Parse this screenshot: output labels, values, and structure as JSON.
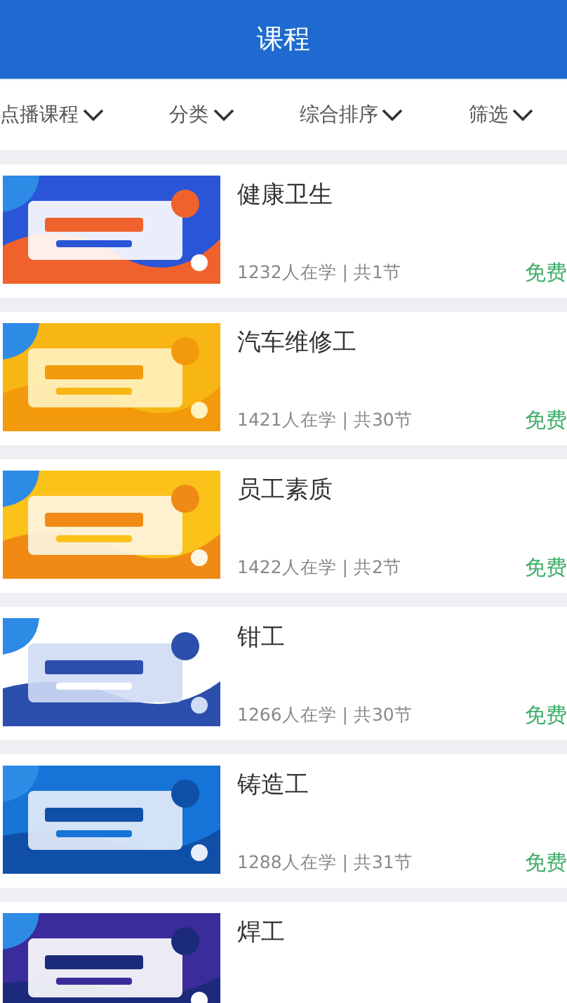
{
  "header": {
    "title": "课程"
  },
  "filters": [
    {
      "label": "点播课程"
    },
    {
      "label": "分类"
    },
    {
      "label": "综合排序"
    },
    {
      "label": "筛选"
    }
  ],
  "courses": [
    {
      "title": "健康卫生",
      "stats": "1232人在学 | 共1节",
      "price": "免费"
    },
    {
      "title": "汽车维修工",
      "stats": "1421人在学 | 共30节",
      "price": "免费"
    },
    {
      "title": "员工素质",
      "stats": "1422人在学 | 共2节",
      "price": "免费"
    },
    {
      "title": "钳工",
      "stats": "1266人在学 | 共30节",
      "price": "免费"
    },
    {
      "title": "铸造工",
      "stats": "1288人在学 | 共31节",
      "price": "免费"
    },
    {
      "title": "焊工"
    }
  ]
}
